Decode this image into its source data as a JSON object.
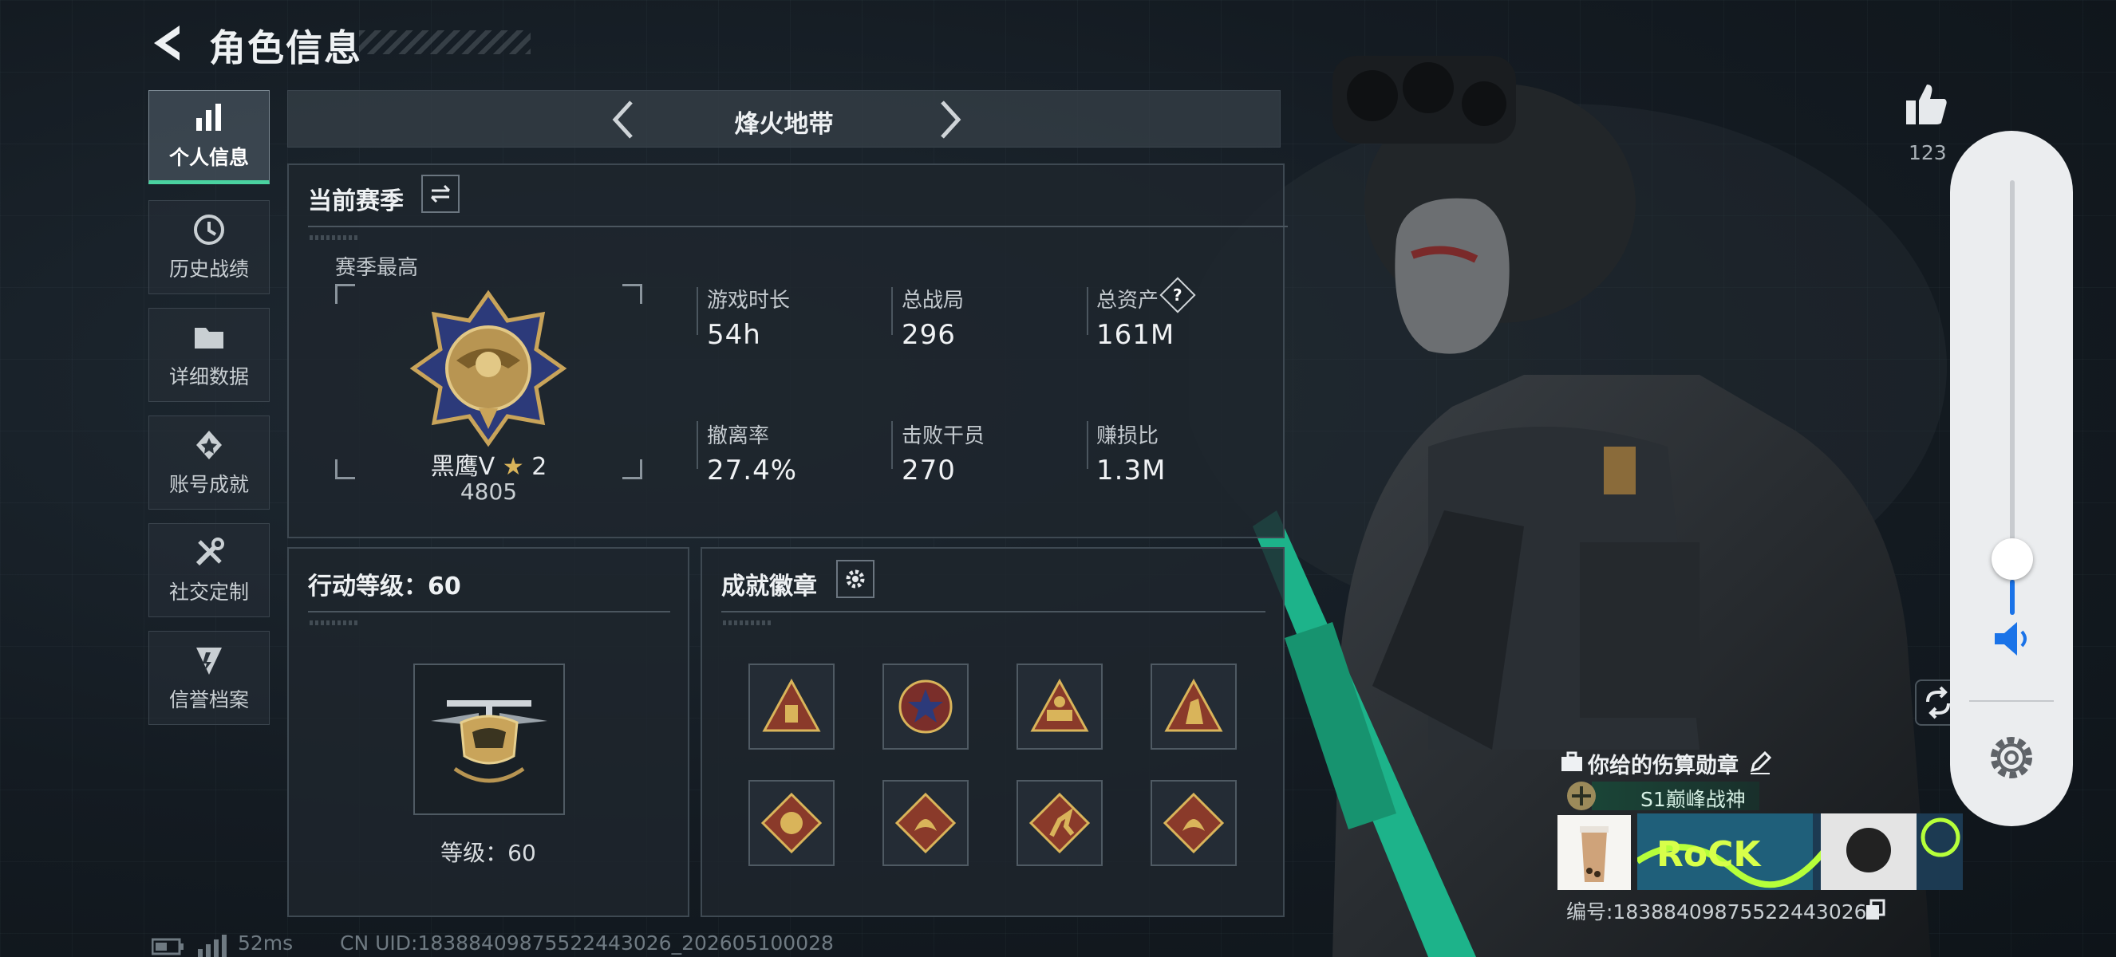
{
  "header": {
    "title": "角色信息"
  },
  "sidebar": {
    "items": [
      {
        "label": "个人信息",
        "icon": "bar-chart-icon",
        "active": true
      },
      {
        "label": "历史战绩",
        "icon": "history-icon"
      },
      {
        "label": "详细数据",
        "icon": "folder-icon"
      },
      {
        "label": "账号成就",
        "icon": "achievement-icon"
      },
      {
        "label": "社交定制",
        "icon": "tools-icon"
      },
      {
        "label": "信誉档案",
        "icon": "shield-icon"
      }
    ]
  },
  "mode": {
    "name": "烽火地带"
  },
  "season": {
    "title": "当前赛季",
    "best_label": "赛季最高",
    "rank_name": "黑鹰Ⅴ",
    "rank_stars": "2",
    "rank_score": "4805",
    "stats": [
      {
        "label": "游戏时长",
        "value": "54h"
      },
      {
        "label": "总战局",
        "value": "296"
      },
      {
        "label": "总资产",
        "value": "161M",
        "help": "?"
      },
      {
        "label": "撤离率",
        "value": "27.4%"
      },
      {
        "label": "击败干员",
        "value": "270"
      },
      {
        "label": "赚损比",
        "value": "1.3M"
      }
    ]
  },
  "level": {
    "title": "行动等级：60",
    "caption": "等级：60"
  },
  "badges": {
    "title": "成就徽章",
    "items": [
      "badge-bag",
      "badge-star",
      "badge-camp",
      "badge-soldier",
      "badge-beast",
      "badge-dragon",
      "badge-runner",
      "badge-dragon2"
    ]
  },
  "status": {
    "latency": "52ms",
    "uid_line": "CN UID:18388409875522443026_202605100028"
  },
  "likes": {
    "count": "123"
  },
  "card": {
    "title": "你给的伤算勋章",
    "tag": "S1巅峰战神",
    "banner_text": "RoCK",
    "id_line": "编号:18388409875522443026"
  },
  "volume": {
    "level": 0.08
  },
  "colors": {
    "accent": "#4ad2a0",
    "volume_blue": "#1a73e8",
    "gold": "#c9a45a"
  }
}
